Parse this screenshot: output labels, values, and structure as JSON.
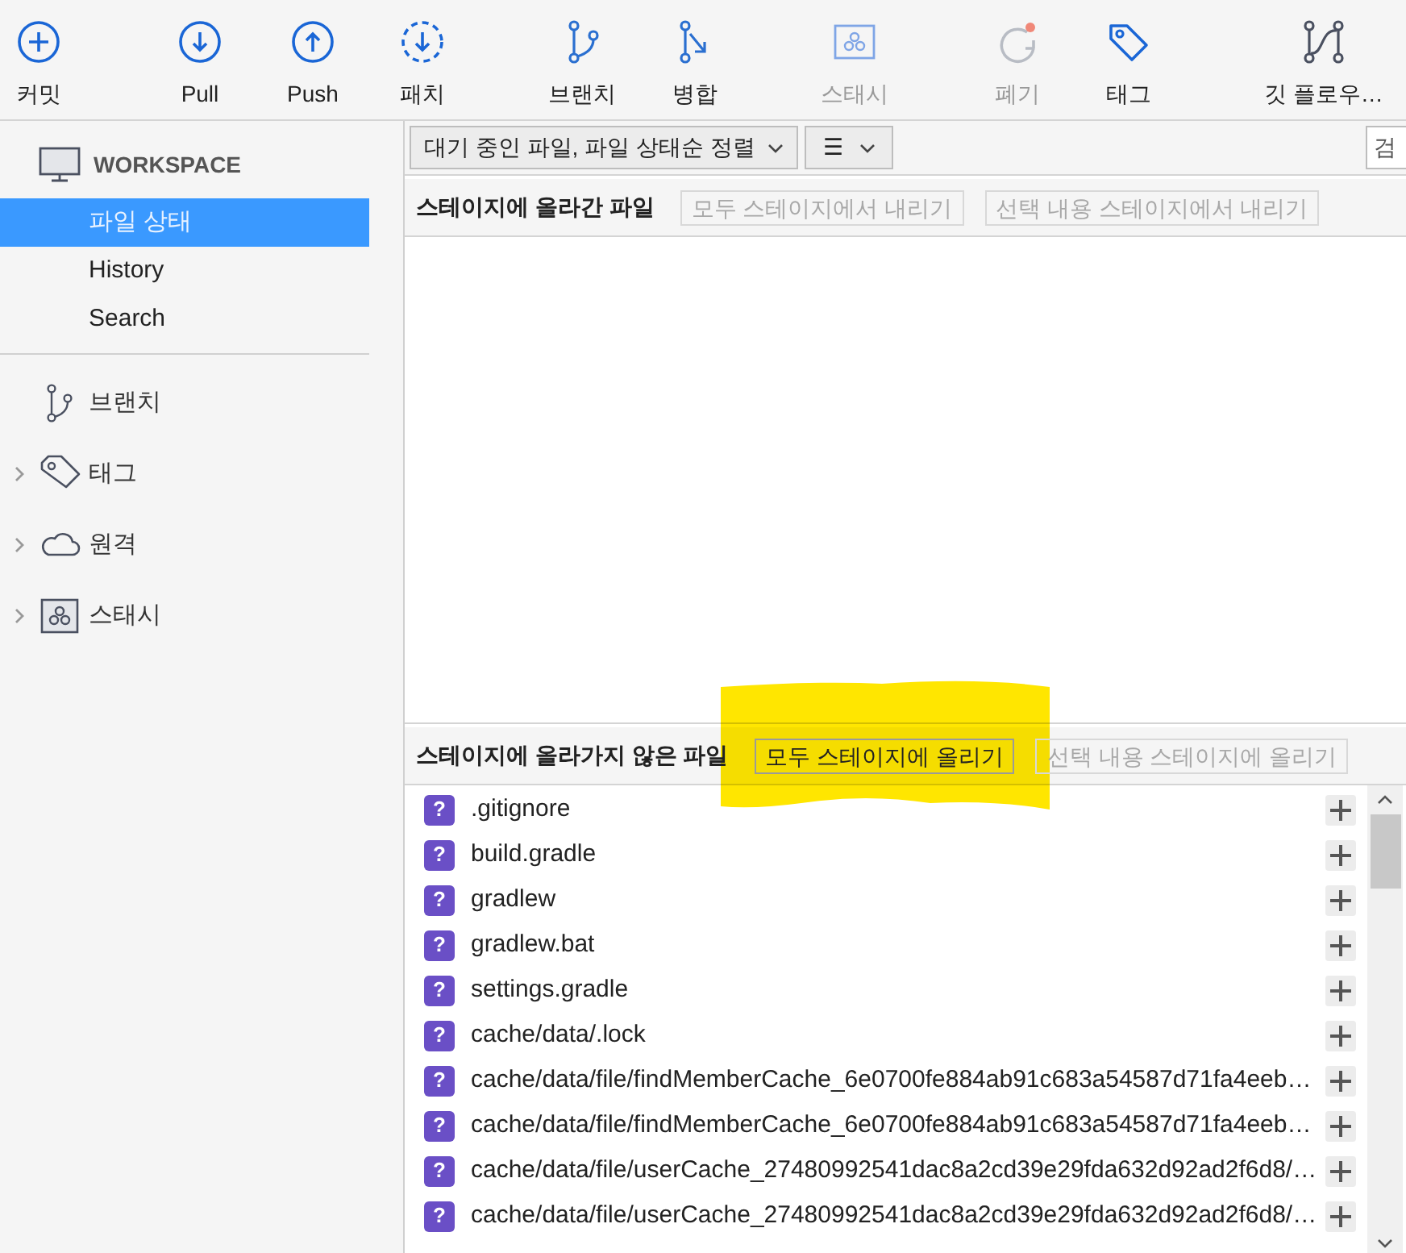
{
  "toolbar": [
    {
      "label": "커밋",
      "disabled": false
    },
    {
      "label": "Pull",
      "disabled": false
    },
    {
      "label": "Push",
      "disabled": false
    },
    {
      "label": "패치",
      "disabled": false
    },
    {
      "label": "브랜치",
      "disabled": false
    },
    {
      "label": "병합",
      "disabled": false
    },
    {
      "label": "스태시",
      "disabled": true
    },
    {
      "label": "폐기",
      "disabled": true
    },
    {
      "label": "태그",
      "disabled": false
    },
    {
      "label": "깃 플로우…",
      "disabled": false
    }
  ],
  "sidebar": {
    "workspace": {
      "title": "WORKSPACE",
      "items": [
        {
          "label": "파일 상태",
          "selected": true
        },
        {
          "label": "History",
          "selected": false
        },
        {
          "label": "Search",
          "selected": false
        }
      ]
    },
    "sections": [
      {
        "label": "브랜치",
        "has_children": false
      },
      {
        "label": "태그",
        "has_children": true,
        "expanded": false
      },
      {
        "label": "원격",
        "has_children": true,
        "expanded": false
      },
      {
        "label": "스태시",
        "has_children": true,
        "expanded": false
      }
    ]
  },
  "filter": {
    "sort_dropdown": "대기 중인 파일, 파일 상태순 정렬",
    "view_dropdown": "☰",
    "search_placeholder": "검"
  },
  "staged": {
    "title": "스테이지에 올라간 파일",
    "buttons": [
      {
        "label": "모두 스테이지에서 내리기",
        "disabled": true
      },
      {
        "label": "선택 내용 스테이지에서 내리기",
        "disabled": true
      }
    ]
  },
  "unstaged": {
    "title": "스테이지에 올라가지 않은 파일",
    "buttons": [
      {
        "label": "모두 스테이지에 올리기",
        "disabled": false
      },
      {
        "label": "선택 내용 스테이지에 올리기",
        "disabled": true
      }
    ],
    "files": [
      {
        "name": ".gitignore",
        "status": "?"
      },
      {
        "name": "build.gradle",
        "status": "?"
      },
      {
        "name": "gradlew",
        "status": "?"
      },
      {
        "name": "gradlew.bat",
        "status": "?"
      },
      {
        "name": "settings.gradle",
        "status": "?"
      },
      {
        "name": "cache/data/.lock",
        "status": "?"
      },
      {
        "name": "cache/data/file/findMemberCache_6e0700fe884ab91c683a54587d71fa4eeb…",
        "status": "?"
      },
      {
        "name": "cache/data/file/findMemberCache_6e0700fe884ab91c683a54587d71fa4eeb…",
        "status": "?"
      },
      {
        "name": "cache/data/file/userCache_27480992541dac8a2cd39e29fda632d92ad2f6d8/…",
        "status": "?"
      },
      {
        "name": "cache/data/file/userCache_27480992541dac8a2cd39e29fda632d92ad2f6d8/…",
        "status": "?"
      }
    ]
  }
}
